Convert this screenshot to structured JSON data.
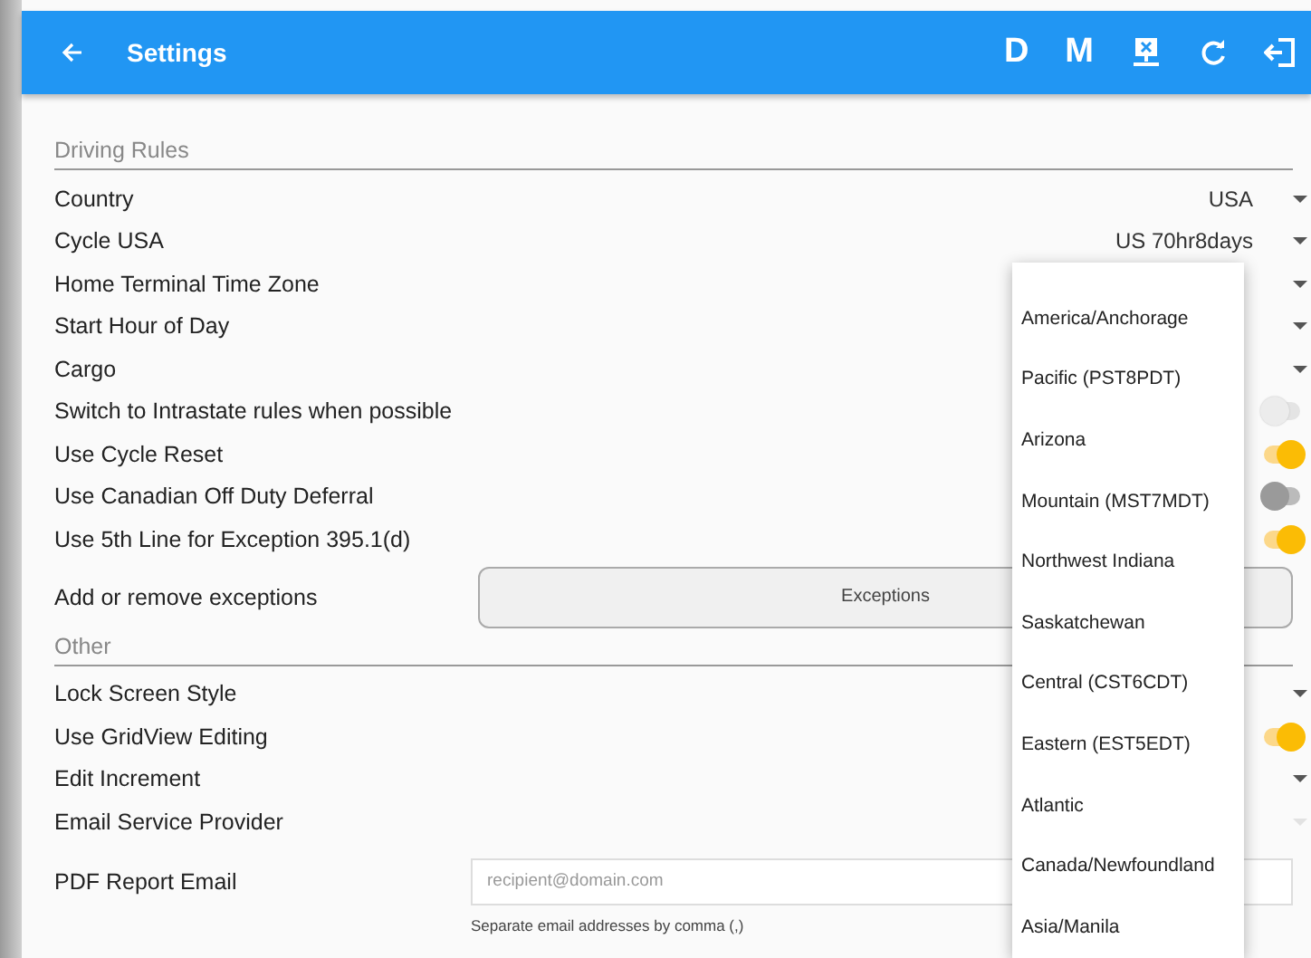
{
  "app_bar": {
    "title": "Settings",
    "actions": [
      {
        "kind": "letter",
        "label": "D"
      },
      {
        "kind": "letter",
        "label": "M"
      },
      {
        "kind": "monitor"
      },
      {
        "kind": "refresh"
      },
      {
        "kind": "logout"
      }
    ]
  },
  "sections": [
    {
      "title": "Driving Rules",
      "rows": [
        {
          "kind": "dropdown",
          "label": "Country",
          "value": "USA",
          "disabled": false
        },
        {
          "kind": "dropdown",
          "label": "Cycle USA",
          "value": "US 70hr8days",
          "disabled": false
        },
        {
          "kind": "dropdown",
          "label": "Home Terminal Time Zone",
          "disabled": false
        },
        {
          "kind": "dropdown",
          "label": "Start Hour of Day",
          "disabled": false
        },
        {
          "kind": "dropdown",
          "label": "Cargo",
          "disabled": false
        },
        {
          "kind": "switch",
          "label": "Switch to Intrastate rules when possible",
          "on": false,
          "disabled": true
        },
        {
          "kind": "switch",
          "label": "Use Cycle Reset",
          "on": true,
          "disabled": false
        },
        {
          "kind": "switch",
          "label": "Use Canadian Off Duty Deferral",
          "on": false,
          "disabled": false
        },
        {
          "kind": "switch",
          "label": "Use 5th Line for Exception 395.1(d)",
          "on": true,
          "disabled": false
        },
        {
          "kind": "button",
          "label": "Add or remove exceptions",
          "button": "Exceptions"
        }
      ]
    },
    {
      "title": "Other",
      "rows": [
        {
          "kind": "dropdown",
          "label": "Lock Screen Style",
          "disabled": false
        },
        {
          "kind": "switch",
          "label": "Use GridView Editing",
          "on": true,
          "disabled": false
        },
        {
          "kind": "dropdown",
          "label": "Edit Increment",
          "disabled": false
        },
        {
          "kind": "dropdown",
          "label": "Email Service Provider",
          "disabled": true
        },
        {
          "kind": "email",
          "label": "PDF Report Email",
          "placeholder": "recipient@domain.com",
          "hint": "Separate email addresses by comma (,)"
        }
      ]
    }
  ],
  "time_zone_menu": {
    "items": [
      {
        "label": "America/Anchorage"
      },
      {
        "label": "Pacific (PST8PDT)"
      },
      {
        "label": "Arizona"
      },
      {
        "label": "Mountain (MST7MDT)"
      },
      {
        "label": "Northwest Indiana"
      },
      {
        "label": "Saskatchewan"
      },
      {
        "label": "Central (CST6CDT)"
      },
      {
        "label": "Eastern (EST5EDT)"
      },
      {
        "label": "Atlantic"
      },
      {
        "label": "Canada/Newfoundland"
      },
      {
        "label": "Asia/Manila"
      }
    ]
  }
}
